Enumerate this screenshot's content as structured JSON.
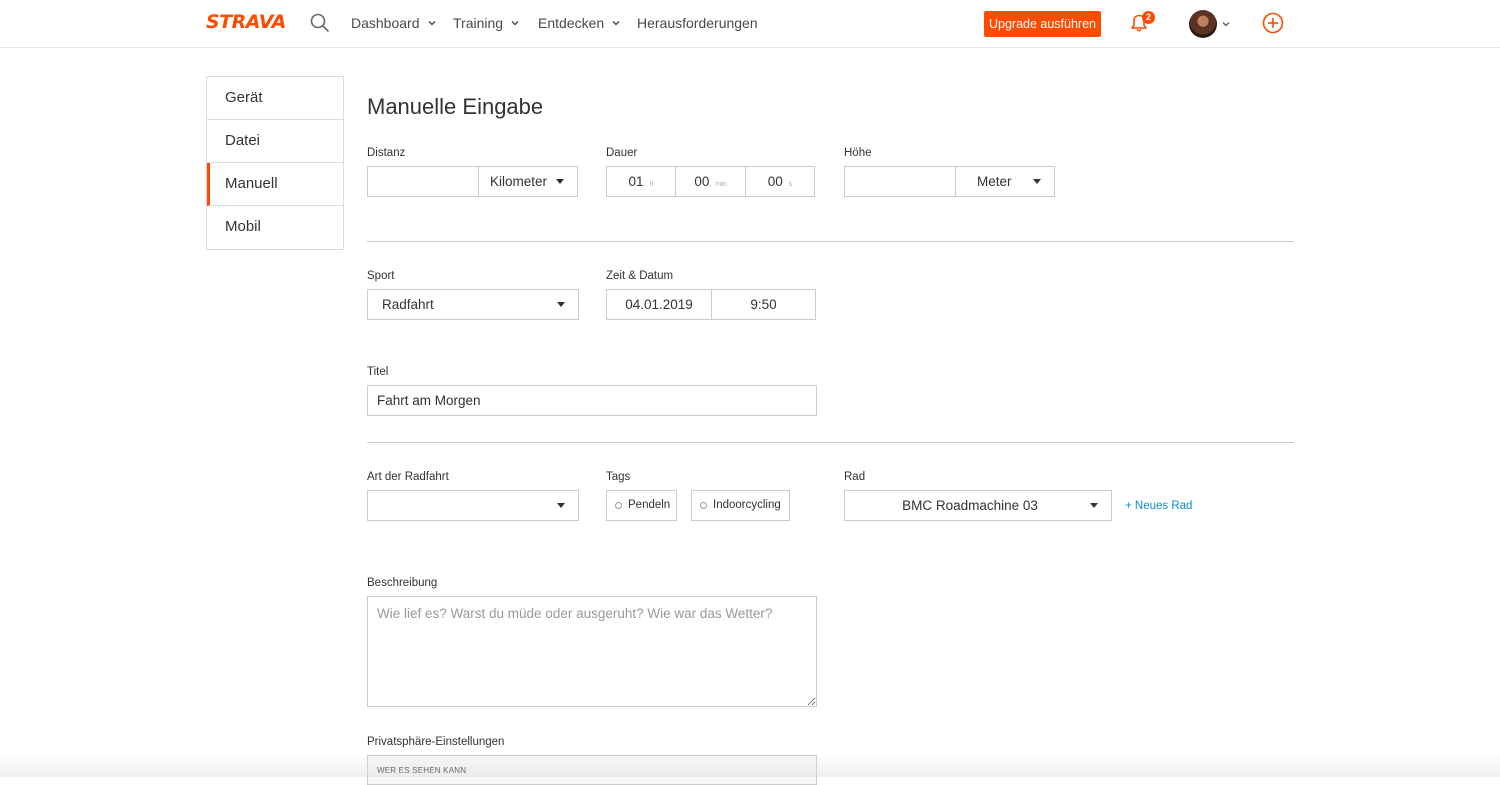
{
  "header": {
    "logo": "STRAVA",
    "nav": [
      {
        "label": "Dashboard",
        "has_menu": true
      },
      {
        "label": "Training",
        "has_menu": true
      },
      {
        "label": "Entdecken",
        "has_menu": true
      },
      {
        "label": "Herausforderungen",
        "has_menu": false
      }
    ],
    "upgrade_label": "Upgrade ausführen",
    "notification_count": "2",
    "icons": [
      "search-icon",
      "bell-icon",
      "avatar",
      "add-circle-icon"
    ],
    "accent": "#fc4c02"
  },
  "sidebar": {
    "items": [
      {
        "label": "Gerät",
        "active": false
      },
      {
        "label": "Datei",
        "active": false
      },
      {
        "label": "Manuell",
        "active": true
      },
      {
        "label": "Mobil",
        "active": false
      }
    ]
  },
  "form": {
    "title": "Manuelle Eingabe",
    "distance": {
      "label": "Distanz",
      "value": "",
      "unit": "Kilometer"
    },
    "duration": {
      "label": "Dauer",
      "hours": "01",
      "hours_unit": "h",
      "minutes": "00",
      "minutes_unit": "min",
      "seconds": "00",
      "seconds_unit": "s"
    },
    "elevation": {
      "label": "Höhe",
      "value": "",
      "unit": "Meter"
    },
    "sport": {
      "label": "Sport",
      "value": "Radfahrt"
    },
    "datetime": {
      "label": "Zeit & Datum",
      "date": "04.01.2019",
      "time": "9:50"
    },
    "title_field": {
      "label": "Titel",
      "value": "Fahrt am Morgen"
    },
    "ride_type": {
      "label": "Art der Radfahrt",
      "value": ""
    },
    "tags": {
      "label": "Tags",
      "items": [
        "Pendeln",
        "Indoorcycling"
      ]
    },
    "bike": {
      "label": "Rad",
      "value": "BMC Roadmachine 03",
      "new_link": "+ Neues Rad"
    },
    "description": {
      "label": "Beschreibung",
      "placeholder": "Wie lief es? Warst du müde oder ausgeruht? Wie war das Wetter?"
    },
    "privacy": {
      "label": "Privatsphäre-Einstellungen",
      "sub_label": "WER ES SEHEN KANN"
    }
  }
}
